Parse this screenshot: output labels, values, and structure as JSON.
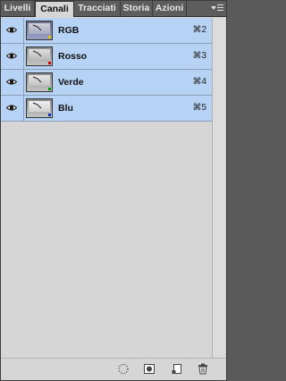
{
  "tabs": [
    {
      "label": "Livelli",
      "active": false
    },
    {
      "label": "Canali",
      "active": true
    },
    {
      "label": "Tracciati",
      "active": false
    },
    {
      "label": "Storia",
      "active": false
    },
    {
      "label": "Azioni",
      "active": false
    }
  ],
  "channels": [
    {
      "name": "RGB",
      "shortcut": "⌘2",
      "thumb": "color",
      "mark_color": "#e0c200"
    },
    {
      "name": "Rosso",
      "shortcut": "⌘3",
      "thumb": "gray",
      "mark_color": "#cc0000"
    },
    {
      "name": "Verde",
      "shortcut": "⌘4",
      "thumb": "gray",
      "mark_color": "#009900"
    },
    {
      "name": "Blu",
      "shortcut": "⌘5",
      "thumb": "gray",
      "mark_color": "#0033cc"
    }
  ],
  "footer_buttons": [
    {
      "name": "load-channel-selection-icon"
    },
    {
      "name": "save-selection-as-channel-icon"
    },
    {
      "name": "new-channel-icon"
    },
    {
      "name": "delete-channel-icon"
    }
  ],
  "colors": {
    "row_selected": "#b6d3f5",
    "panel_bg": "#d6d6d6",
    "tabbar_bg": "#5d5d5d"
  }
}
